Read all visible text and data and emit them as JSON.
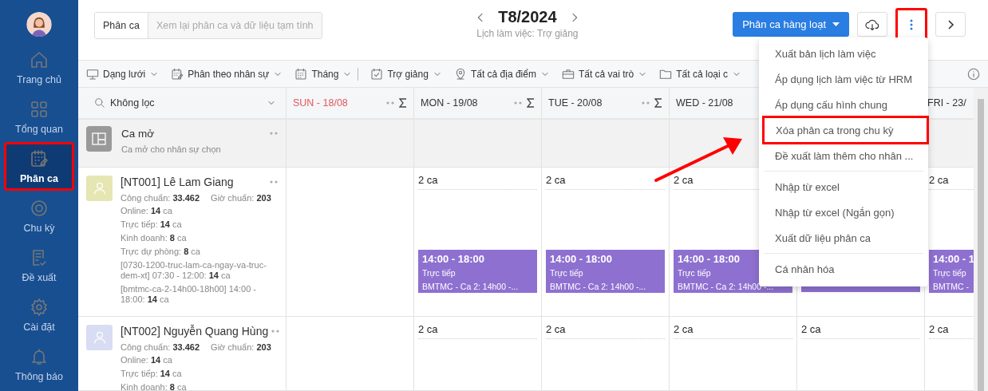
{
  "sidebar": {
    "items": [
      {
        "label": "Trang chủ",
        "selected": false,
        "marked": false
      },
      {
        "label": "Tổng quan",
        "selected": false,
        "marked": false
      },
      {
        "label": "Phân ca",
        "selected": true,
        "marked": true
      },
      {
        "label": "Chu kỳ",
        "selected": false,
        "marked": false
      },
      {
        "label": "Đề xuất",
        "selected": false,
        "marked": false
      },
      {
        "label": "Cài đặt",
        "selected": false,
        "marked": false
      },
      {
        "label": "Thông báo",
        "selected": false,
        "marked": false
      }
    ]
  },
  "header": {
    "tabs": [
      {
        "label": "Phân ca",
        "selected": true
      },
      {
        "label": "Xem lại phân ca và dữ liệu tạm tính",
        "selected": false
      }
    ],
    "period": {
      "title": "T8/2024",
      "subtitle": "Lịch làm việc: Trợ giảng"
    },
    "bulk_button": "Phân ca hàng loạt",
    "more_button": {
      "marked": true
    }
  },
  "toolbar": {
    "groups": [
      [
        "Dạng lưới",
        "Phân theo nhân sự",
        "Tháng"
      ],
      [
        "Trợ giảng",
        "Tất cả địa điểm",
        "Tất cả vai trò",
        "Tất cả loại c"
      ]
    ]
  },
  "grid": {
    "filter": {
      "value": "Không lọc"
    },
    "days": [
      {
        "kind": "day",
        "label": "SUN - 18/08",
        "color": "#e0575b"
      },
      {
        "kind": "day",
        "label": "MON - 19/08",
        "color": "#333333"
      },
      {
        "kind": "day",
        "label": "TUE - 20/08",
        "color": "#333333"
      },
      {
        "kind": "label_only",
        "label": "WED - 21/08",
        "color": "#333333"
      },
      {
        "kind": "covered"
      },
      {
        "kind": "label_only",
        "label": "FRI - 23/",
        "color": "#333333"
      }
    ],
    "open_shift": {
      "title": "Ca mở",
      "subtitle": "Ca mở cho nhân sự chọn"
    },
    "employees": [
      {
        "name": "[NT001] Lê Lam Giang",
        "color": "#e6e6b3",
        "standard": [
          "Công chuẩn: **33.462**",
          "Giờ chuẩn: **203**"
        ],
        "stats": [
          "Online: **14** ca",
          "Trực tiếp: **14** ca",
          "Kinh doanh: **8** ca",
          "Trực dự phòng: **8** ca",
          "[0730-1200-truc-lam-ca-ngay-va-truc-dem-xt] 07:30 - 12:00: **14** ca",
          "[bmtmc-ca-2-14h00-18h00] 14:00 - 18:00: **14** ca"
        ],
        "cells": [
          {},
          {
            "count": "2 ca",
            "shifts": [
              {
                "time": "14:00 - 18:00",
                "type": "Trực tiếp",
                "name": "BMTMC - Ca 2: 14h00 -..."
              }
            ]
          },
          {
            "count": "2 ca",
            "shifts": [
              {
                "time": "14:00 - 18:00",
                "type": "Trực tiếp",
                "name": "BMTMC - Ca 2: 14h00 -..."
              }
            ]
          },
          {
            "count": "2 ca",
            "shifts": [
              {
                "time": "14:00 - 18:00",
                "type": "Trực tiếp",
                "name": "BMTMC - Ca 2: 14h00 -..."
              }
            ]
          },
          {
            "covered_shift": true
          },
          {
            "count": "2 ca",
            "shifts": [
              {
                "time": "14:00 - 1",
                "type": "Trực tiếp",
                "name": "BMTMC -"
              }
            ]
          }
        ]
      },
      {
        "name": "[NT002] Nguyễn Quang Hùng",
        "color": "#d9ddf3",
        "standard": [
          "Công chuẩn: **33.462**",
          "Giờ chuẩn: **203**"
        ],
        "stats": [
          "Online: **14** ca",
          "Trực tiếp: **14** ca",
          "Kinh doanh: **8** ca"
        ],
        "cells": [
          {},
          {
            "count": "2 ca"
          },
          {
            "count": "2 ca"
          },
          {
            "count": "2 ca"
          },
          {
            "count": "2 ca"
          },
          {
            "count": "2 ca"
          }
        ]
      }
    ]
  },
  "menu": {
    "groups": [
      [
        {
          "label": "Xuất bản lịch làm việc",
          "marked": false
        },
        {
          "label": "Áp dụng lịch làm việc từ HRM",
          "marked": false
        },
        {
          "label": "Áp dụng cấu hình chung",
          "marked": false
        },
        {
          "label": "Xóa phân ca trong chu kỳ",
          "marked": true
        },
        {
          "label": "Đề xuất làm thêm cho nhân ...",
          "marked": false
        }
      ],
      [
        {
          "label": "Nhập từ excel",
          "marked": false
        },
        {
          "label": "Nhập từ excel (Ngắn gọn)",
          "marked": false
        },
        {
          "label": "Xuất dữ liệu phân ca",
          "marked": false
        }
      ],
      [
        {
          "label": "Cá nhân hóa",
          "marked": false
        }
      ]
    ]
  }
}
